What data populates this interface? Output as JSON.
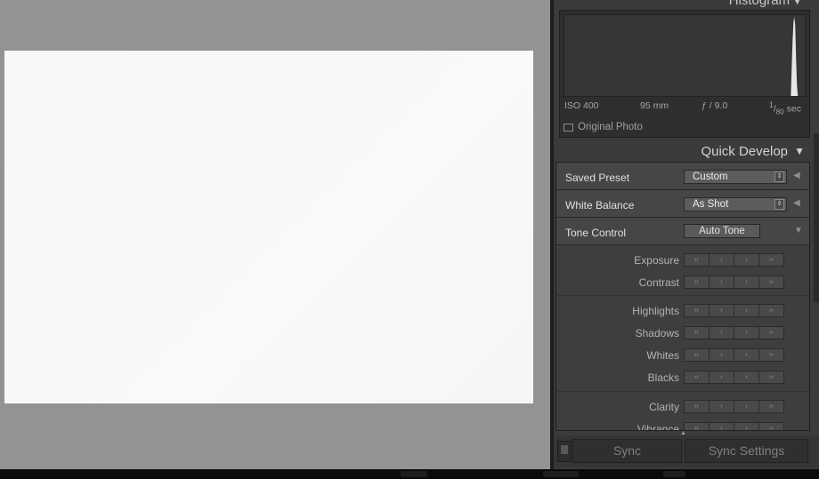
{
  "histogram": {
    "title": "Histogram",
    "iso": "ISO 400",
    "focal_length": "95 mm",
    "aperture": "ƒ / 9.0",
    "shutter_num": "1",
    "shutter_den": "80",
    "shutter_unit": "sec",
    "original_photo_label": "Original Photo"
  },
  "quick_develop": {
    "title": "Quick Develop",
    "saved_preset": {
      "label": "Saved Preset",
      "value": "Custom"
    },
    "white_balance": {
      "label": "White Balance",
      "value": "As Shot"
    },
    "tone_control": {
      "label": "Tone Control",
      "auto_tone": "Auto Tone"
    },
    "adjustments_group1": [
      "Exposure",
      "Contrast"
    ],
    "adjustments_group2": [
      "Highlights",
      "Shadows",
      "Whites",
      "Blacks"
    ],
    "adjustments_group3": [
      "Clarity",
      "Vibrance"
    ],
    "step_glyphs": [
      "‹‹",
      "‹",
      "›",
      "››"
    ]
  },
  "sync": {
    "sync_label": "Sync",
    "sync_settings_label": "Sync Settings"
  },
  "icons": {
    "panel_collapse": "triangle-down-icon",
    "row_expand": "triangle-left-icon",
    "select_arrows": "updown-arrows-icon"
  }
}
